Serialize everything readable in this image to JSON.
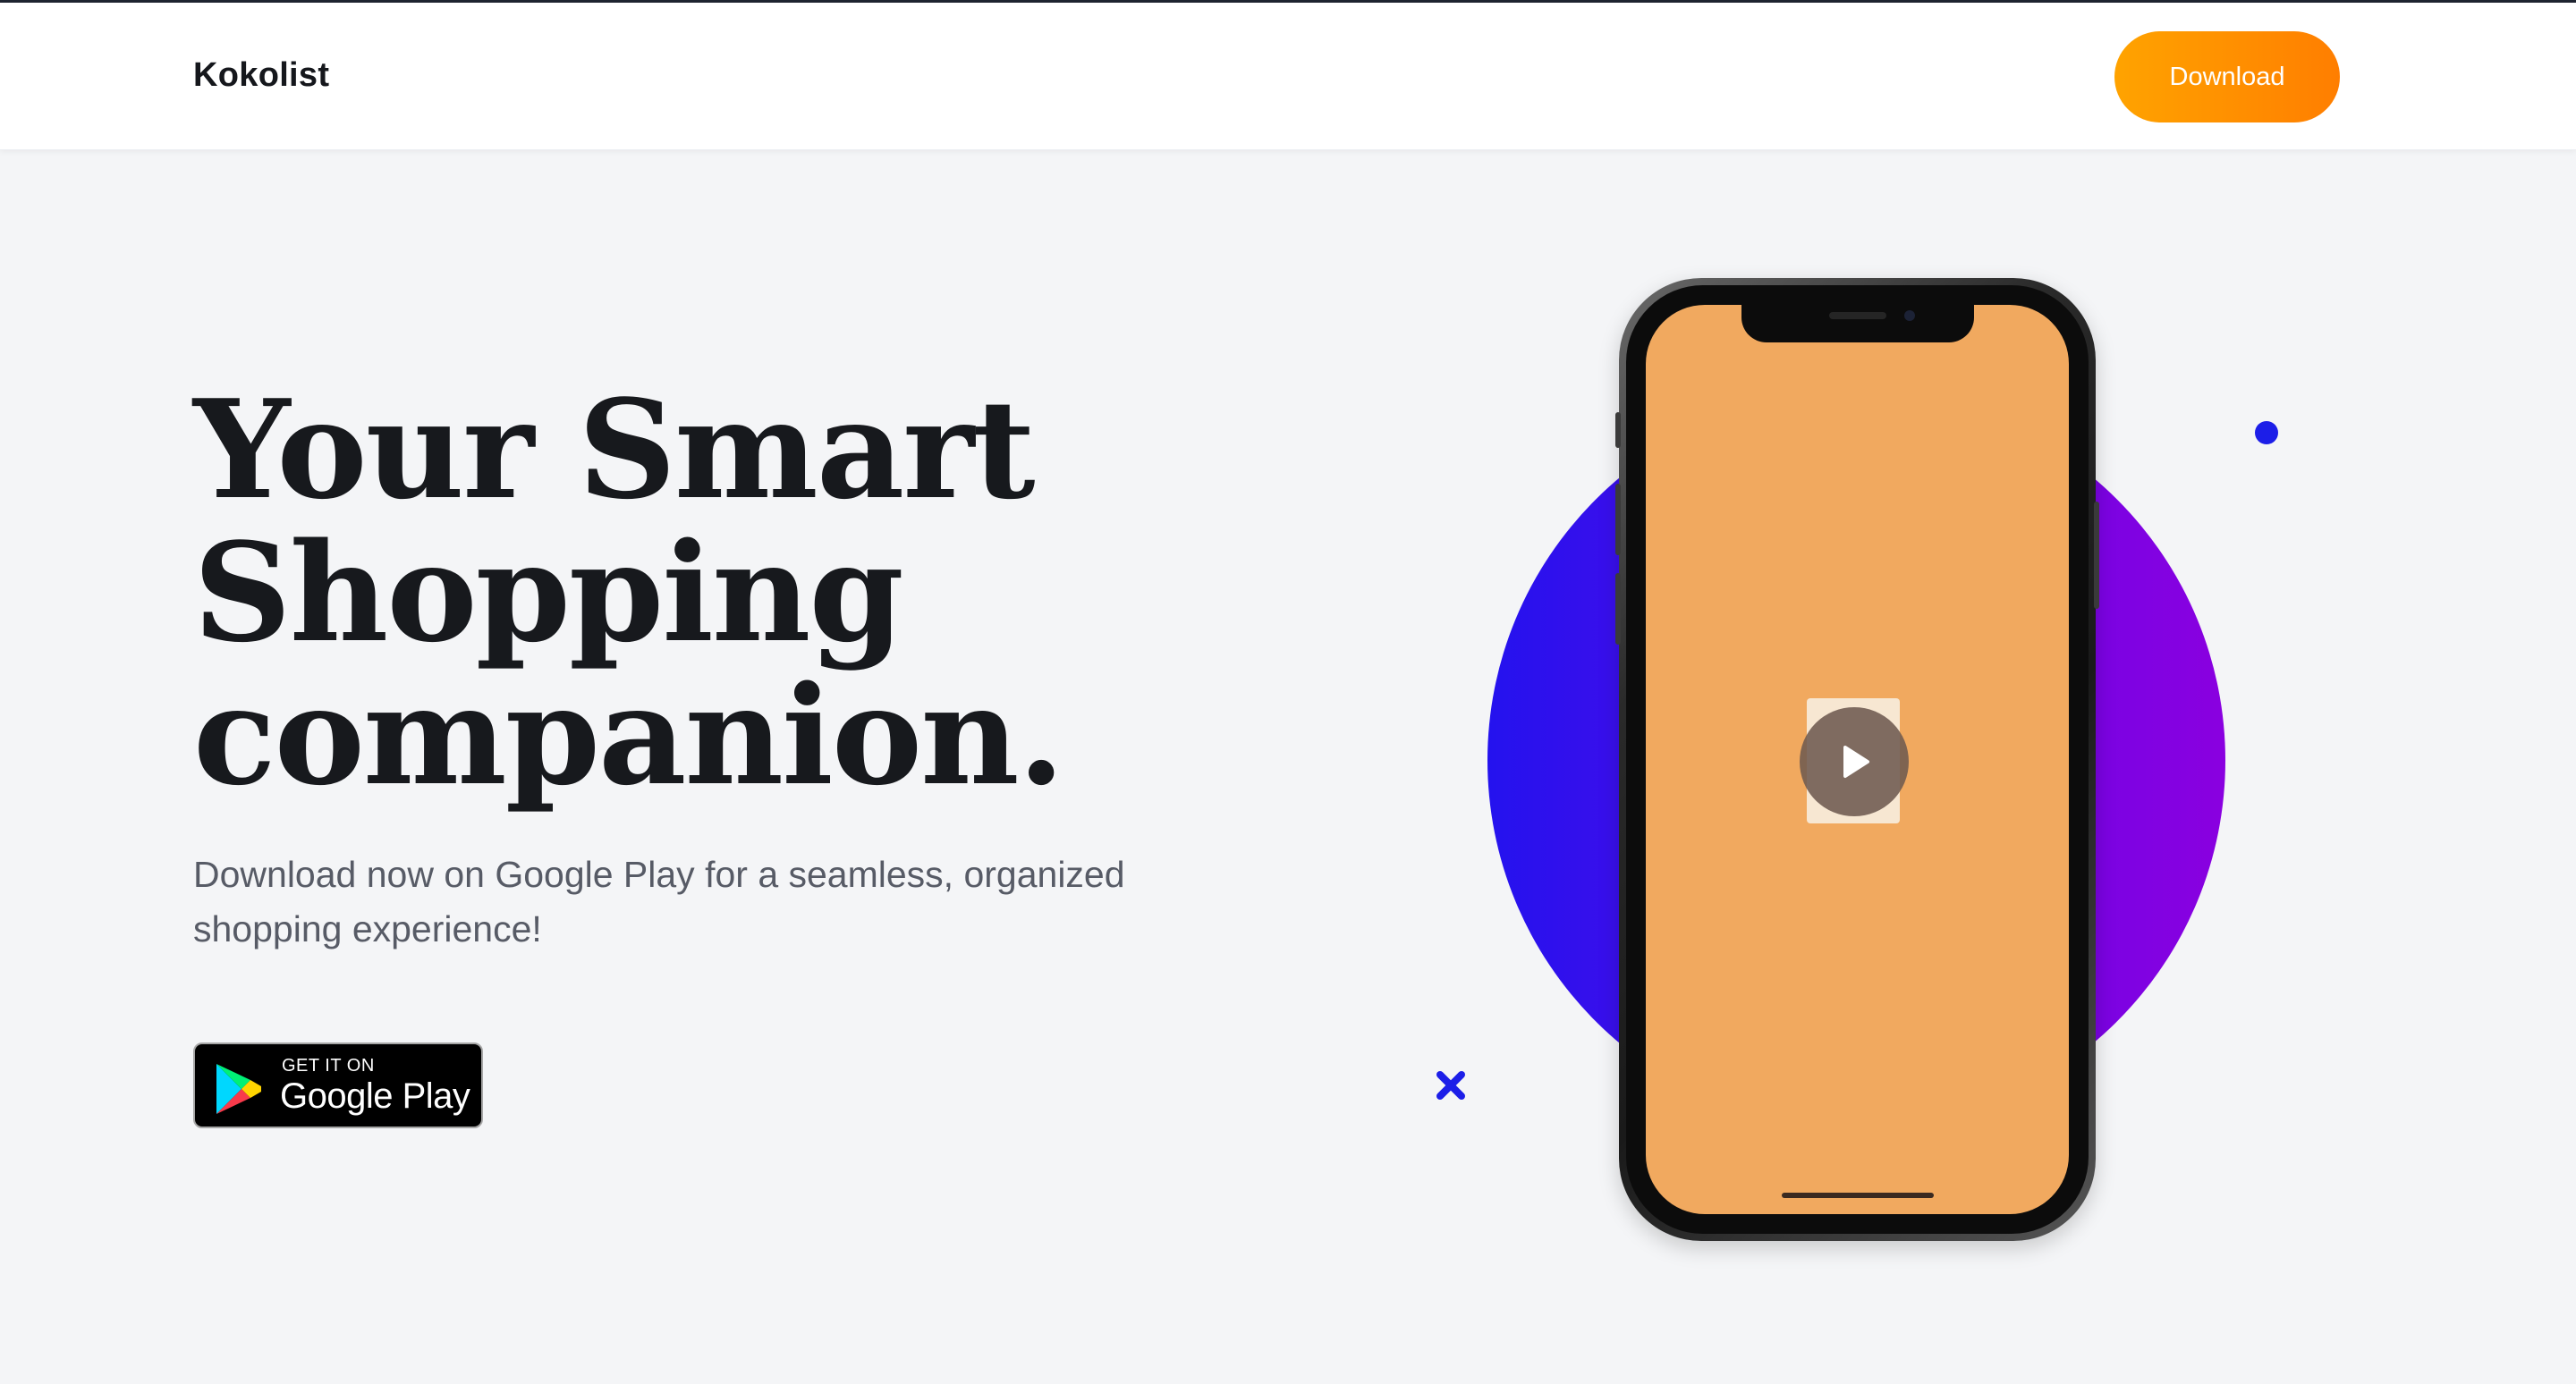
{
  "header": {
    "brand": "Kokolist",
    "download_label": "Download"
  },
  "hero": {
    "title_lines": [
      "Your Smart",
      "Shopping",
      "companion."
    ],
    "subtitle_line1": "Download now on Google Play for a seamless, organized",
    "subtitle_line2": "shopping experience!"
  },
  "store_badge": {
    "small_text": "GET IT ON",
    "store_name": "Google Play"
  },
  "colors": {
    "accent_orange_start": "#ffa300",
    "accent_orange_end": "#ff7e00",
    "circle_blue": "#2412ee",
    "circle_purple": "#8a00e0",
    "phone_screen": "#f1a95f",
    "deco_blue": "#1c1ee8"
  },
  "icons": {
    "play_video": "play-icon",
    "store_logo": "google-play-logo-icon",
    "decoration_dot": "dot-icon",
    "decoration_x": "x-mark-icon"
  }
}
